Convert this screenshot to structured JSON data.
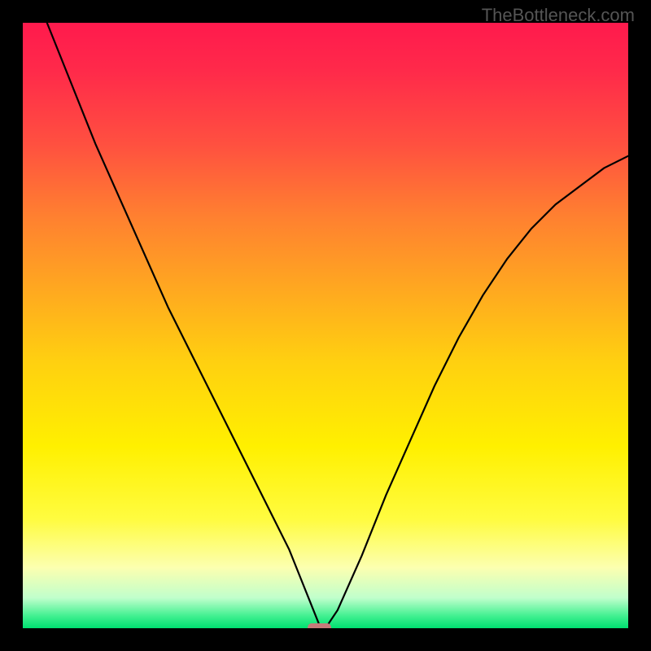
{
  "watermark": "TheBottleneck.com",
  "chart_data": {
    "type": "line",
    "title": "",
    "xlabel": "",
    "ylabel": "",
    "xlim": [
      0,
      100
    ],
    "ylim": [
      0,
      100
    ],
    "series": [
      {
        "name": "bottleneck-curve",
        "x": [
          4,
          8,
          12,
          16,
          20,
          24,
          28,
          32,
          36,
          40,
          44,
          46,
          48,
          49,
          50,
          52,
          56,
          60,
          64,
          68,
          72,
          76,
          80,
          84,
          88,
          92,
          96,
          100
        ],
        "y": [
          100,
          90,
          80,
          71,
          62,
          53,
          45,
          37,
          29,
          21,
          13,
          8,
          3,
          0.5,
          0,
          3,
          12,
          22,
          31,
          40,
          48,
          55,
          61,
          66,
          70,
          73,
          76,
          78
        ]
      }
    ],
    "marker": {
      "x_range": [
        47,
        51
      ],
      "y": 0,
      "color": "#c77a7a"
    },
    "gradient_colors": {
      "top": "#ff1a4d",
      "upper_mid": "#ffa820",
      "mid": "#fff000",
      "lower_mid": "#fcffb0",
      "bottom": "#00e070"
    }
  }
}
